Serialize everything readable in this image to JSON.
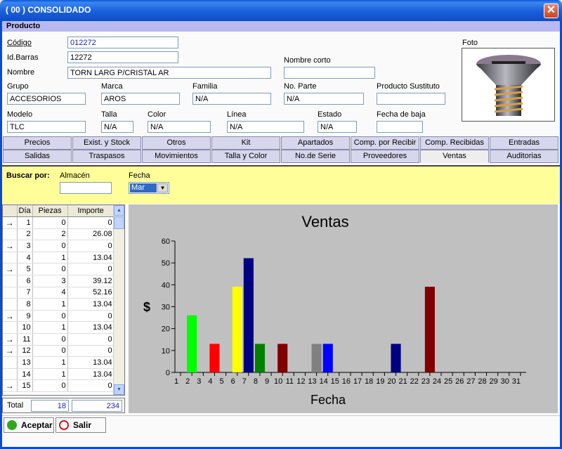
{
  "window": {
    "title": "( 00 ) CONSOLIDADO",
    "close": "✕"
  },
  "section": "Producto",
  "fields": {
    "codigo": {
      "label": "Código",
      "value": "012272"
    },
    "barras": {
      "label": "Id.Barras",
      "value": "12272"
    },
    "nombre": {
      "label": "Nombre",
      "value": "TORN LARG P/CRISTAL AR"
    },
    "nombre_corto": {
      "label": "Nombre corto",
      "value": ""
    },
    "grupo": {
      "label": "Grupo",
      "value": "ACCESORIOS"
    },
    "marca": {
      "label": "Marca",
      "value": "AROS"
    },
    "familia": {
      "label": "Familia",
      "value": "N/A"
    },
    "no_parte": {
      "label": "No. Parte",
      "value": "N/A"
    },
    "sustituto": {
      "label": "Producto Sustituto",
      "value": ""
    },
    "modelo": {
      "label": "Modelo",
      "value": "TLC"
    },
    "talla": {
      "label": "Talla",
      "value": "N/A"
    },
    "color": {
      "label": "Color",
      "value": "N/A"
    },
    "linea": {
      "label": "Línea",
      "value": "N/A"
    },
    "estado": {
      "label": "Estado",
      "value": "N/A"
    },
    "fecha_baja": {
      "label": "Fecha de baja",
      "value": ""
    },
    "foto": {
      "label": "Foto"
    }
  },
  "tabs_row1": [
    "Precios",
    "Exist. y Stock",
    "Otros",
    "Kit",
    "Apartados",
    "Comp. por Recibir",
    "Comp. Recibidas",
    "Entradas"
  ],
  "tabs_row2": [
    "Salidas",
    "Traspasos",
    "Movimientos",
    "Talla y Color",
    "No.de Serie",
    "Proveedores",
    "Ventas",
    "Auditorias"
  ],
  "active_tab": "Ventas",
  "search": {
    "label": "Buscar por:",
    "almacen_label": "Almacén",
    "almacen_value": "",
    "fecha_label": "Fecha",
    "fecha_value": "Mar"
  },
  "grid": {
    "headers": [
      "Día",
      "Piezas",
      "Importe"
    ],
    "rows": [
      {
        "arrow": true,
        "dia": "1",
        "piezas": "0",
        "importe": "0"
      },
      {
        "arrow": false,
        "dia": "2",
        "piezas": "2",
        "importe": "26.08"
      },
      {
        "arrow": true,
        "dia": "3",
        "piezas": "0",
        "importe": "0"
      },
      {
        "arrow": false,
        "dia": "4",
        "piezas": "1",
        "importe": "13.04"
      },
      {
        "arrow": true,
        "dia": "5",
        "piezas": "0",
        "importe": "0"
      },
      {
        "arrow": false,
        "dia": "6",
        "piezas": "3",
        "importe": "39.12"
      },
      {
        "arrow": false,
        "dia": "7",
        "piezas": "4",
        "importe": "52.16"
      },
      {
        "arrow": false,
        "dia": "8",
        "piezas": "1",
        "importe": "13.04"
      },
      {
        "arrow": true,
        "dia": "9",
        "piezas": "0",
        "importe": "0"
      },
      {
        "arrow": false,
        "dia": "10",
        "piezas": "1",
        "importe": "13.04"
      },
      {
        "arrow": true,
        "dia": "11",
        "piezas": "0",
        "importe": "0"
      },
      {
        "arrow": true,
        "dia": "12",
        "piezas": "0",
        "importe": "0"
      },
      {
        "arrow": false,
        "dia": "13",
        "piezas": "1",
        "importe": "13.04"
      },
      {
        "arrow": false,
        "dia": "14",
        "piezas": "1",
        "importe": "13.04"
      },
      {
        "arrow": true,
        "dia": "15",
        "piezas": "0",
        "importe": "0"
      }
    ],
    "total_label": "Total",
    "total_piezas": "18",
    "total_importe": "234"
  },
  "buttons": {
    "accept": "Aceptar",
    "exit": "Salir"
  },
  "chart_data": {
    "type": "bar",
    "title": "Ventas",
    "xlabel": "Fecha",
    "ylabel": "$",
    "ylim": [
      0,
      60
    ],
    "yticks": [
      0,
      10,
      20,
      30,
      40,
      50,
      60
    ],
    "categories": [
      "1",
      "2",
      "3",
      "4",
      "5",
      "6",
      "7",
      "8",
      "9",
      "10",
      "11",
      "12",
      "13",
      "14",
      "15",
      "16",
      "17",
      "18",
      "19",
      "20",
      "21",
      "22",
      "23",
      "24",
      "25",
      "26",
      "27",
      "28",
      "29",
      "30",
      "31"
    ],
    "values": [
      0,
      26.08,
      0,
      13.04,
      0,
      39.12,
      52.16,
      13.04,
      0,
      13.04,
      0,
      0,
      13.04,
      13.04,
      0,
      0,
      0,
      0,
      0,
      13.04,
      0,
      0,
      39.12,
      0,
      0,
      0,
      0,
      0,
      0,
      0,
      0
    ],
    "colors": [
      "#000000",
      "#00ff00",
      "#000000",
      "#ff0000",
      "#000000",
      "#ffff00",
      "#000080",
      "#008000",
      "#000000",
      "#800000",
      "#000000",
      "#000000",
      "#808080",
      "#0000ff",
      "#000000",
      "#000000",
      "#000000",
      "#000000",
      "#000000",
      "#000080",
      "#000000",
      "#000000",
      "#800000",
      "#000000",
      "#000000",
      "#000000",
      "#000000",
      "#000000",
      "#000000",
      "#000000",
      "#000000"
    ],
    "background": "#c0c0c0"
  }
}
